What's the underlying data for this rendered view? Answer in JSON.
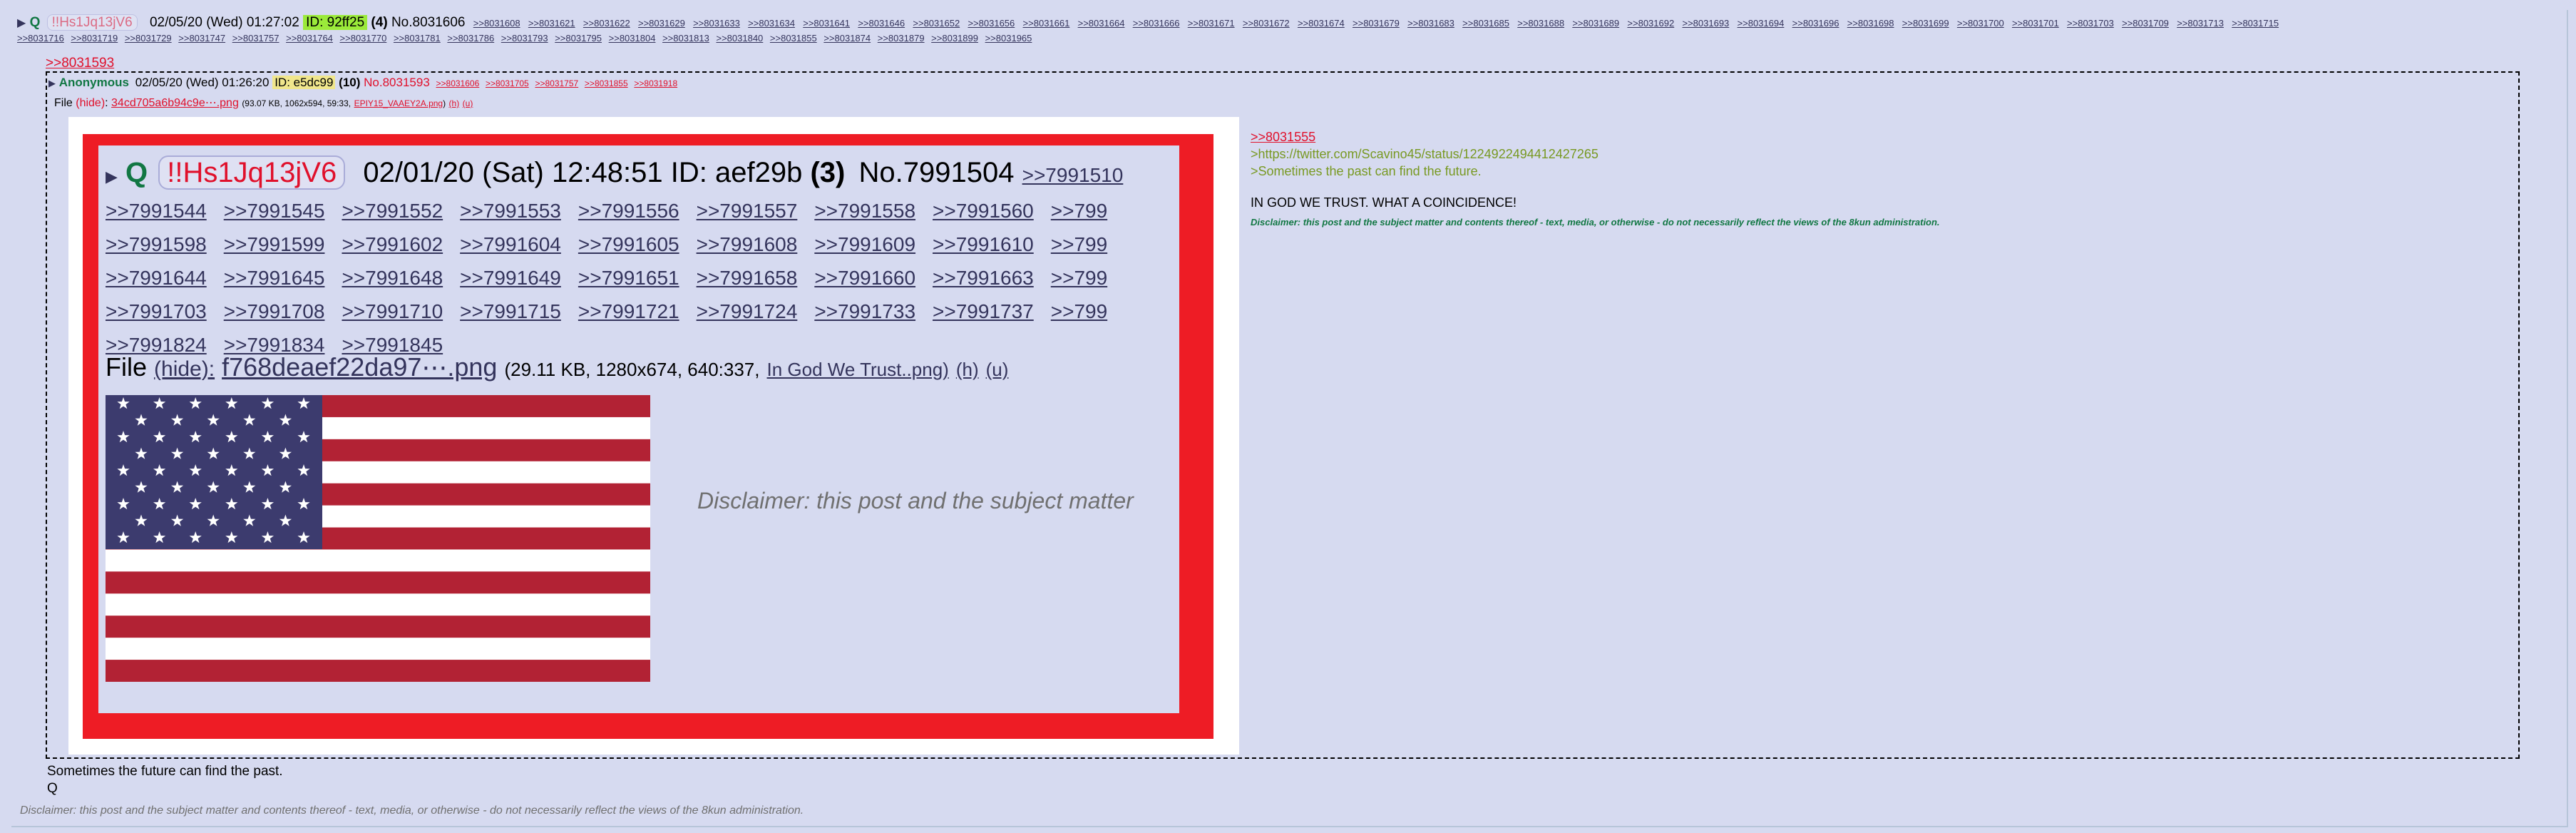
{
  "header": {
    "caret": "▶",
    "name": "Q",
    "tripcode": "!!Hs1Jq13jV6",
    "datetime": "02/05/20 (Wed) 01:27:02",
    "id": "ID: 92ff25",
    "id_count": "(4)",
    "post_no": "No.8031606",
    "backlinks_row1": [
      ">>8031608",
      ">>8031621",
      ">>8031622",
      ">>8031629",
      ">>8031633",
      ">>8031634",
      ">>8031641",
      ">>8031646",
      ">>8031652",
      ">>8031656",
      ">>8031661",
      ">>8031664",
      ">>8031666",
      ">>8031671",
      ">>8031672",
      ">>8031674",
      ">>8031679",
      ">>8031683",
      ">>8031685",
      ">>8031688",
      ">>8031689",
      ">>8031692",
      ">>8031693",
      ">>8031694",
      ">>8031696",
      ">>8031698",
      ">>8031699",
      ">>8031700",
      ">>8031701",
      ">>8031703",
      ">>8031709",
      ">>8031713",
      ">>8031715"
    ],
    "backlinks_row2": [
      ">>8031716",
      ">>8031719",
      ">>8031729",
      ">>8031747",
      ">>8031757",
      ">>8031764",
      ">>8031770",
      ">>8031781",
      ">>8031786",
      ">>8031793",
      ">>8031795",
      ">>8031804",
      ">>8031813",
      ">>8031840",
      ">>8031855",
      ">>8031874",
      ">>8031879",
      ">>8031899",
      ">>8031965"
    ]
  },
  "quote": {
    "ref": ">>8031593",
    "caret": "▶",
    "name": "Anonymous",
    "datetime": "02/05/20 (Wed) 01:26:20",
    "id": "ID: e5dc99",
    "id_count": "(10)",
    "post_no": "No.8031593",
    "backlinks": [
      ">>8031606",
      ">>8031705",
      ">>8031757",
      ">>8031855",
      ">>8031918"
    ],
    "file_label": "File",
    "file_hide": "(hide)",
    "file_name": "34cd705a6b94c9e⋯.png",
    "file_meta": "(93.07 KB, 1062x594, 59:33,",
    "file_orig": "EPIY15_VAAEY2A.png",
    "file_h": "(h)",
    "file_u": "(u)",
    "text_ref": ">>8031555",
    "text_url": ">https://twitter.com/Scavino45/status/1224922494412427265",
    "text_green": ">Sometimes the past can find the future.",
    "text_caps": "IN GOD WE TRUST. WHAT A COINCIDENCE!",
    "text_disc": "Disclaimer: this post and the subject matter and contents thereof - text, media, or otherwise - do not necessarily reflect the views of the 8kun administration."
  },
  "shot": {
    "caret": "▶",
    "name": "Q",
    "tripcode": "!!Hs1Jq13jV6",
    "datetime": "02/01/20 (Sat) 12:48:51",
    "id": "ID: aef29b",
    "id_count": "(3)",
    "post_no": "No.7991504",
    "first_link": ">>7991510",
    "link_rows": [
      [
        ">>7991544",
        ">>7991545",
        ">>7991552",
        ">>7991553",
        ">>7991556",
        ">>7991557",
        ">>7991558",
        ">>7991560",
        ">>799"
      ],
      [
        ">>7991598",
        ">>7991599",
        ">>7991602",
        ">>7991604",
        ">>7991605",
        ">>7991608",
        ">>7991609",
        ">>7991610",
        ">>799"
      ],
      [
        ">>7991644",
        ">>7991645",
        ">>7991648",
        ">>7991649",
        ">>7991651",
        ">>7991658",
        ">>7991660",
        ">>7991663",
        ">>799"
      ],
      [
        ">>7991703",
        ">>7991708",
        ">>7991710",
        ">>7991715",
        ">>7991721",
        ">>7991724",
        ">>7991733",
        ">>7991737",
        ">>799"
      ],
      [
        ">>7991824",
        ">>7991834",
        ">>7991845"
      ]
    ],
    "file_label": "File",
    "file_hide": "(hide):",
    "file_name": "f768deaef22da97⋯.png",
    "file_meta": "(29.11 KB, 1280x674, 640:337,",
    "file_orig": "In God We Trust..png)",
    "file_h": "(h)",
    "file_u": "(u)",
    "disclaimer": "Disclaimer: this post and the subject matter"
  },
  "body": {
    "line1": "Sometimes the future can find the past.",
    "line2": "Q"
  },
  "footer_disclaimer": "Disclaimer: this post and the subject matter and contents thereof - text, media, or otherwise - do not necessarily reflect the views of the 8kun administration.",
  "colors": {
    "background": "#d6daf0",
    "link": "#34345c",
    "red_link": "#e0102b",
    "name_green": "#117743",
    "greentext": "#789922",
    "frame_red": "#ee1c25"
  }
}
